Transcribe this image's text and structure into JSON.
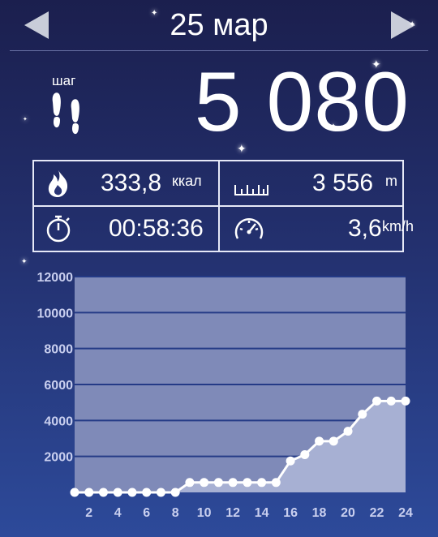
{
  "header": {
    "date": "25 мар",
    "prev_icon": "left-triangle-arrow",
    "next_icon": "right-triangle-arrow"
  },
  "steps": {
    "label": "шаг",
    "value": "5 080",
    "icon": "footprints"
  },
  "stats": {
    "calories": {
      "value": "333,8",
      "unit": "ккал",
      "icon": "flame"
    },
    "distance": {
      "value": "3 556",
      "unit": "m",
      "icon": "ruler"
    },
    "duration": {
      "value": "00:58:36",
      "icon": "stopwatch"
    },
    "speed": {
      "value": "3,6",
      "unit": "km/h",
      "icon": "speedometer"
    }
  },
  "colors": {
    "accent": "#ffffff",
    "plot_bg": "#7f8ab8",
    "grid": "#243a86",
    "fill": "#a7b0d3"
  },
  "chart_data": {
    "type": "area",
    "x": [
      1,
      2,
      3,
      4,
      5,
      6,
      7,
      8,
      9,
      10,
      11,
      12,
      13,
      14,
      15,
      16,
      17,
      18,
      19,
      20,
      21,
      22,
      23,
      24
    ],
    "values": [
      0,
      0,
      0,
      0,
      0,
      0,
      0,
      0,
      550,
      550,
      550,
      550,
      550,
      550,
      550,
      1750,
      2100,
      2850,
      2850,
      3400,
      4350,
      5080,
      5080,
      5080
    ],
    "xticks": [
      "2",
      "4",
      "6",
      "8",
      "10",
      "12",
      "14",
      "16",
      "18",
      "20",
      "22",
      "24"
    ],
    "yticks": [
      "2000",
      "4000",
      "6000",
      "8000",
      "10000",
      "12000"
    ],
    "ylim": [
      0,
      12000
    ],
    "xlim": [
      1,
      24
    ],
    "grid": true
  }
}
